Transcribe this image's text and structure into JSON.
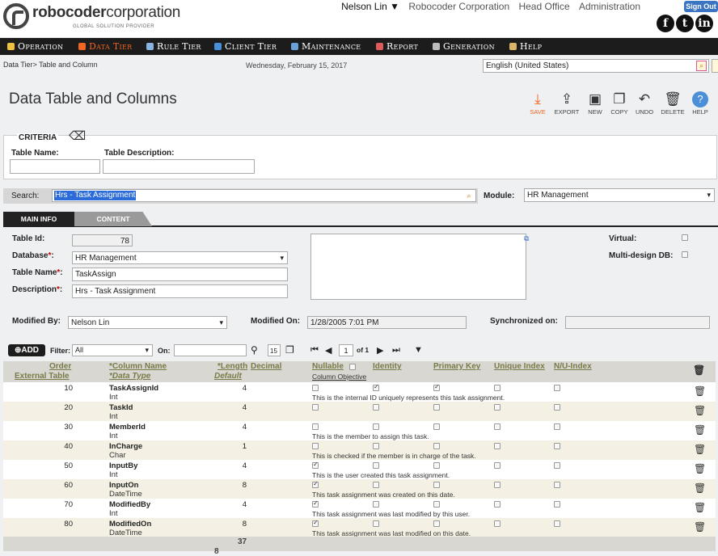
{
  "brand": {
    "name_bold": "robocoder",
    "name_light": "corporation",
    "tagline": "GLOBAL SOLUTION PROVIDER"
  },
  "top": {
    "user": "Nelson Lin ▼",
    "company": "Robocoder Corporation",
    "office": "Head Office",
    "admin": "Administration",
    "signout": "Sign Out"
  },
  "social": [
    {
      "name": "facebook-icon",
      "glyph": "f"
    },
    {
      "name": "twitter-icon",
      "glyph": "t"
    },
    {
      "name": "linkedin-icon",
      "glyph": "in"
    }
  ],
  "nav": [
    {
      "label": "Operation",
      "color": "#f0c040"
    },
    {
      "label": "Data Tier",
      "color": "#f26522"
    },
    {
      "label": "Rule Tier",
      "color": "#8ab4e0"
    },
    {
      "label": "Client Tier",
      "color": "#4a90d9"
    },
    {
      "label": "Maintenance",
      "color": "#6aa0d8"
    },
    {
      "label": "Report",
      "color": "#e05a5a"
    },
    {
      "label": "Generation",
      "color": "#bbb"
    },
    {
      "label": "Help",
      "color": "#d9b46a"
    }
  ],
  "breadcrumb": "Data Tier> Table and Column",
  "date": "Wednesday, February 15, 2017",
  "language": "English (United States)",
  "page_title": "Data Table and Columns",
  "tools": [
    {
      "name": "save",
      "label": "SAVE",
      "glyph": "⤓"
    },
    {
      "name": "export",
      "label": "EXPORT",
      "glyph": "⇪"
    },
    {
      "name": "new",
      "label": "NEW",
      "glyph": "▣"
    },
    {
      "name": "copy",
      "label": "COPY",
      "glyph": "❐"
    },
    {
      "name": "undo",
      "label": "UNDO",
      "glyph": "↶"
    },
    {
      "name": "delete",
      "label": "DELETE",
      "glyph": "🗑"
    },
    {
      "name": "help",
      "label": "HELP",
      "glyph": "?"
    }
  ],
  "criteria": {
    "legend": "CRITERIA",
    "table_name_label": "Table Name:",
    "table_desc_label": "Table Description:",
    "table_name": "",
    "table_desc": ""
  },
  "search": {
    "label": "Search:",
    "value": "Hrs - Task Assignment",
    "module_label": "Module:",
    "module": "HR Management"
  },
  "tabs": {
    "main": "MAIN INFO",
    "content": "CONTENT"
  },
  "form": {
    "table_id_label": "Table Id:",
    "table_id": "78",
    "database_label": "Database",
    "database": "HR Management",
    "table_name_label": "Table Name",
    "table_name": "TaskAssign",
    "description_label": "Description",
    "description": "Hrs - Task Assignment",
    "notes": "",
    "virtual_label": "Virtual:",
    "multi_label": "Multi-design DB:",
    "modified_by_label": "Modified By:",
    "modified_by": "Nelson Lin",
    "modified_on_label": "Modified On:",
    "modified_on": "1/28/2005 7:01 PM",
    "sync_label": "Synchronized on:",
    "sync": ""
  },
  "grid_toolbar": {
    "add": "⊕ADD",
    "filter_label": "Filter:",
    "filter": "All",
    "on_label": "On:",
    "on_value": "",
    "page_size": "15",
    "page": "1",
    "of": "of 1"
  },
  "columns": {
    "order": "Order",
    "external": "External Table",
    "column_name": "*Column Name",
    "data_type": "*Data Type",
    "length": "*Length",
    "default": "Default",
    "decimal": "Decimal",
    "nullable": "Nullable",
    "objective": "Column Objective",
    "identity": "Identity",
    "primary": "Primary Key",
    "unique": "Unique Index",
    "nu_index": "N/U-Index"
  },
  "rows": [
    {
      "order": "10",
      "name": "TaskAssignId",
      "type": "Int",
      "length": "4",
      "nullable": false,
      "identity": true,
      "primary": true,
      "objective": "This is the internal ID uniquely represents this task assignment."
    },
    {
      "order": "20",
      "name": "TaskId",
      "type": "Int",
      "length": "4",
      "nullable": false,
      "identity": false,
      "primary": false,
      "objective": ""
    },
    {
      "order": "30",
      "name": "MemberId",
      "type": "Int",
      "length": "4",
      "nullable": false,
      "identity": false,
      "primary": false,
      "objective": "This is the member to assign this task."
    },
    {
      "order": "40",
      "name": "InCharge",
      "type": "Char",
      "length": "1",
      "nullable": false,
      "identity": false,
      "primary": false,
      "objective": "This is checked if the member is in charge of the task."
    },
    {
      "order": "50",
      "name": "InputBy",
      "type": "Int",
      "length": "4",
      "nullable": true,
      "identity": false,
      "primary": false,
      "objective": "This is the user created this task assignment."
    },
    {
      "order": "60",
      "name": "InputOn",
      "type": "DateTime",
      "length": "8",
      "nullable": true,
      "identity": false,
      "primary": false,
      "objective": "This task assignment was created on this date."
    },
    {
      "order": "70",
      "name": "ModifiedBy",
      "type": "Int",
      "length": "4",
      "nullable": true,
      "identity": false,
      "primary": false,
      "objective": "This task assignment was last modified by this user."
    },
    {
      "order": "80",
      "name": "ModifiedOn",
      "type": "DateTime",
      "length": "8",
      "nullable": true,
      "identity": false,
      "primary": false,
      "objective": "This task assignment was last modified on this date."
    }
  ],
  "footer": {
    "total_length": "37",
    "count": "8"
  }
}
